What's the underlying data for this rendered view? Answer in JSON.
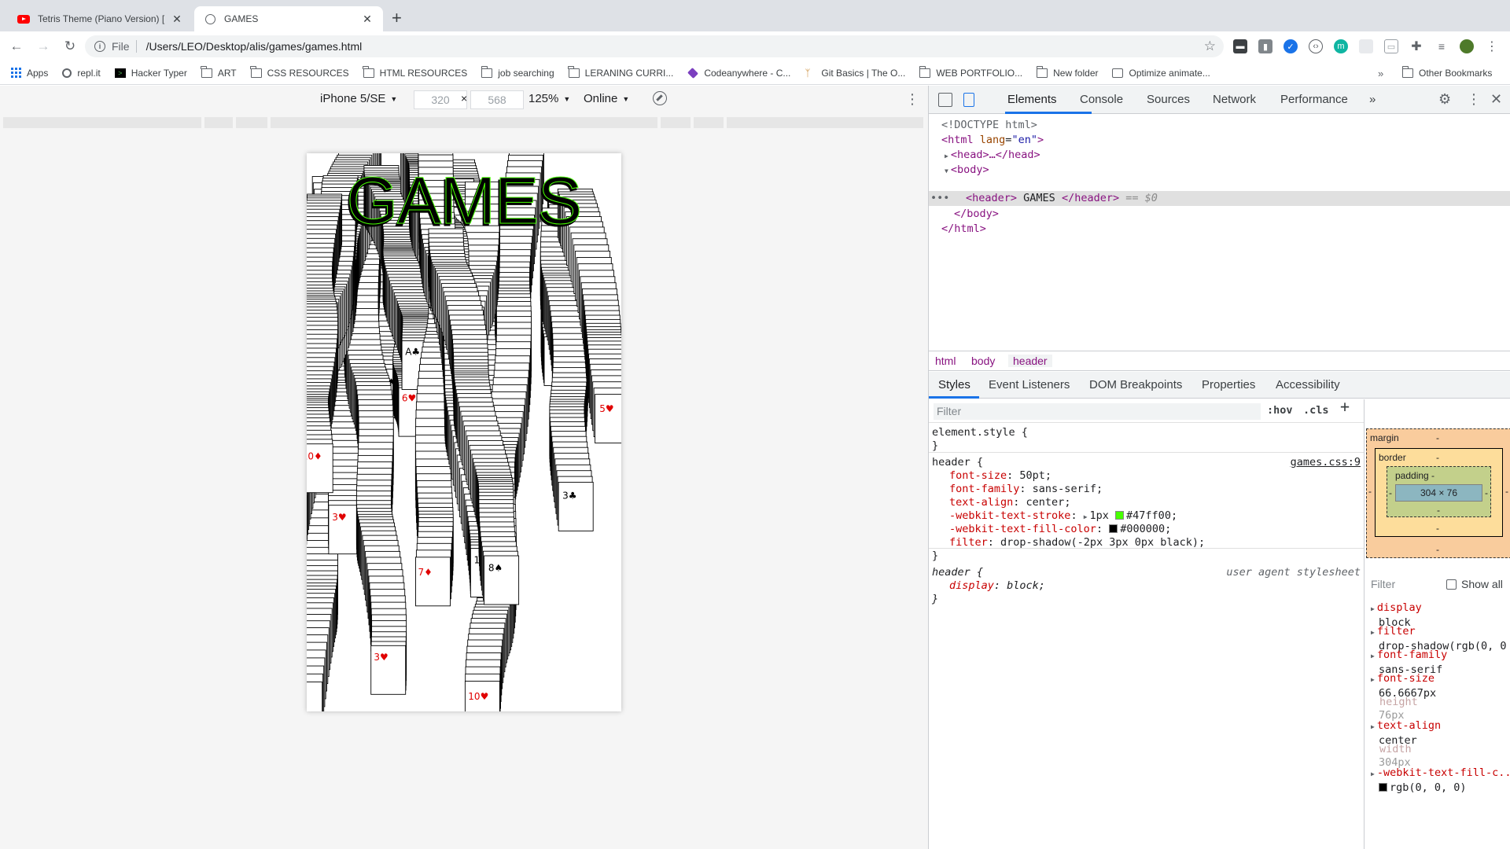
{
  "tabs": [
    {
      "title": "Tetris Theme (Piano Version) [",
      "icon": "youtube-icon"
    },
    {
      "title": "GAMES",
      "icon": "globe-icon"
    }
  ],
  "toolbar": {
    "scheme": "File",
    "url": "/Users/LEO/Desktop/alis/games/games.html"
  },
  "bookmarks": [
    {
      "label": "Apps",
      "icon": "apps-icon"
    },
    {
      "label": "repl.it",
      "icon": "replit-icon"
    },
    {
      "label": "Hacker Typer",
      "icon": "terminal-icon"
    },
    {
      "label": "ART",
      "icon": "folder-icon"
    },
    {
      "label": "CSS RESOURCES",
      "icon": "folder-icon"
    },
    {
      "label": "HTML RESOURCES",
      "icon": "folder-icon"
    },
    {
      "label": "job searching",
      "icon": "folder-icon"
    },
    {
      "label": "LERANING CURRI...",
      "icon": "folder-icon"
    },
    {
      "label": "Codeanywhere - C...",
      "icon": "cube-icon"
    },
    {
      "label": "Git Basics | The O...",
      "icon": "odin-icon"
    },
    {
      "label": "WEB PORTFOLIO...",
      "icon": "folder-icon"
    },
    {
      "label": "New folder",
      "icon": "folder-icon"
    },
    {
      "label": "Optimize animate...",
      "icon": "image-icon"
    }
  ],
  "other_bookmarks": "Other Bookmarks",
  "device_toolbar": {
    "device": "iPhone 5/SE",
    "width": "320",
    "height": "568",
    "times": "×",
    "zoom": "125%",
    "network": "Online"
  },
  "page": {
    "header_text": "GAMES",
    "stroke_color": "#47ff00",
    "fill_color": "#000000"
  },
  "devtools": {
    "tabs": [
      "Elements",
      "Console",
      "Sources",
      "Network",
      "Performance",
      "»"
    ],
    "dom": {
      "doctype": "<!DOCTYPE html>",
      "html_open": "<html",
      "lang_attr": "lang",
      "lang_val": "\"en\"",
      "head": "<head>…</head>",
      "body_open": "<body>",
      "header_open": "<header>",
      "header_text": " GAMES ",
      "header_close": "</header>",
      "eq_selected": " == $0",
      "body_close": "</body>",
      "html_close": "</html>"
    },
    "breadcrumbs": [
      "html",
      "body",
      "header"
    ],
    "subtabs": [
      "Styles",
      "Event Listeners",
      "DOM Breakpoints",
      "Properties",
      "Accessibility"
    ],
    "styles": {
      "filter_placeholder": "Filter",
      "hov": ":hov",
      "cls": ".cls",
      "element_style": "element.style {",
      "close": "}",
      "header_selector": "header {",
      "source": "games.css:9",
      "props": [
        {
          "name": "font-size",
          "value": "50pt;"
        },
        {
          "name": "font-family",
          "value": "sans-serif;"
        },
        {
          "name": "text-align",
          "value": "center;"
        },
        {
          "name": "-webkit-text-stroke",
          "value": "1px #47ff00;",
          "swatch": "#47ff00"
        },
        {
          "name": "-webkit-text-fill-color",
          "value": "#000000;",
          "swatch": "#000000"
        },
        {
          "name": "filter",
          "value": "drop-shadow(-2px 3px 0px black);"
        }
      ],
      "ua_selector": "header {",
      "ua_label": "user agent stylesheet",
      "ua_prop": {
        "name": "display",
        "value": "block;"
      }
    },
    "box_model": {
      "margin_label": "margin",
      "border_label": "border",
      "padding_label": "padding -",
      "content": "304 × 76",
      "dash": "-"
    },
    "computed": {
      "filter_placeholder": "Filter",
      "show_all": "Show all",
      "props": [
        {
          "name": "display",
          "value": "block",
          "dim": false
        },
        {
          "name": "filter",
          "value": "drop-shadow(rgb(0, 0",
          "dim": false
        },
        {
          "name": "font-family",
          "value": "sans-serif",
          "dim": false
        },
        {
          "name": "font-size",
          "value": "66.6667px",
          "dim": false
        },
        {
          "name": "height",
          "value": "76px",
          "dim": true
        },
        {
          "name": "text-align",
          "value": "center",
          "dim": false
        },
        {
          "name": "width",
          "value": "304px",
          "dim": true
        },
        {
          "name": "-webkit-text-fill-c...",
          "value": "rgb(0, 0, 0)",
          "dim": false
        }
      ]
    }
  }
}
